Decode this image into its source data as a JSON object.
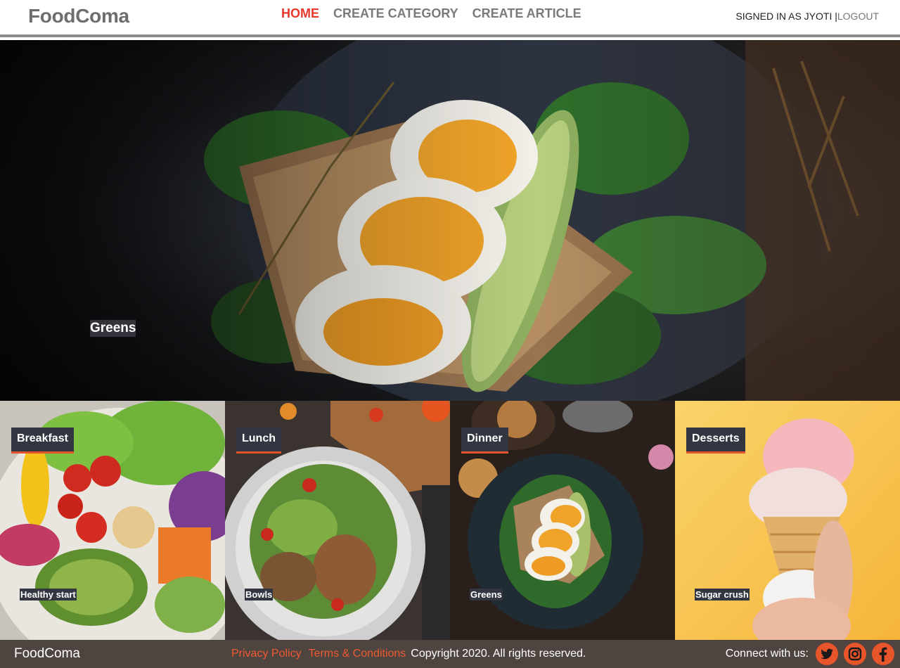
{
  "header": {
    "logo": "FoodComa",
    "nav": [
      {
        "label": "HOME",
        "active": true
      },
      {
        "label": "CREATE CATEGORY",
        "active": false
      },
      {
        "label": "CREATE ARTICLE",
        "active": false
      }
    ],
    "signed_in": "SIGNED IN AS JYOTI |",
    "logout": "LOGOUT"
  },
  "hero": {
    "caption": "Greens",
    "image": "hero-eggs-on-toast-image"
  },
  "categories": [
    {
      "title": "Breakfast",
      "subtitle": "Healthy start",
      "image": "salad-bowl-image"
    },
    {
      "title": "Lunch",
      "subtitle": "Bowls",
      "image": "salad-plate-image"
    },
    {
      "title": "Dinner",
      "subtitle": "Greens",
      "image": "eggs-on-toast-image"
    },
    {
      "title": "Desserts",
      "subtitle": "Sugar crush",
      "image": "ice-cream-cone-image"
    }
  ],
  "footer": {
    "logo": "FoodComa",
    "privacy": "Privacy Policy",
    "terms": "Terms & Conditions",
    "copyright": "Copyright 2020. All rights reserved.",
    "connect": "Connect with us:",
    "social": [
      "twitter-icon",
      "instagram-icon",
      "facebook-icon"
    ]
  },
  "colors": {
    "accent": "#e8372c",
    "link": "#ef5a2f",
    "footer_bg": "#4e4541",
    "label_bg": "#333640"
  }
}
